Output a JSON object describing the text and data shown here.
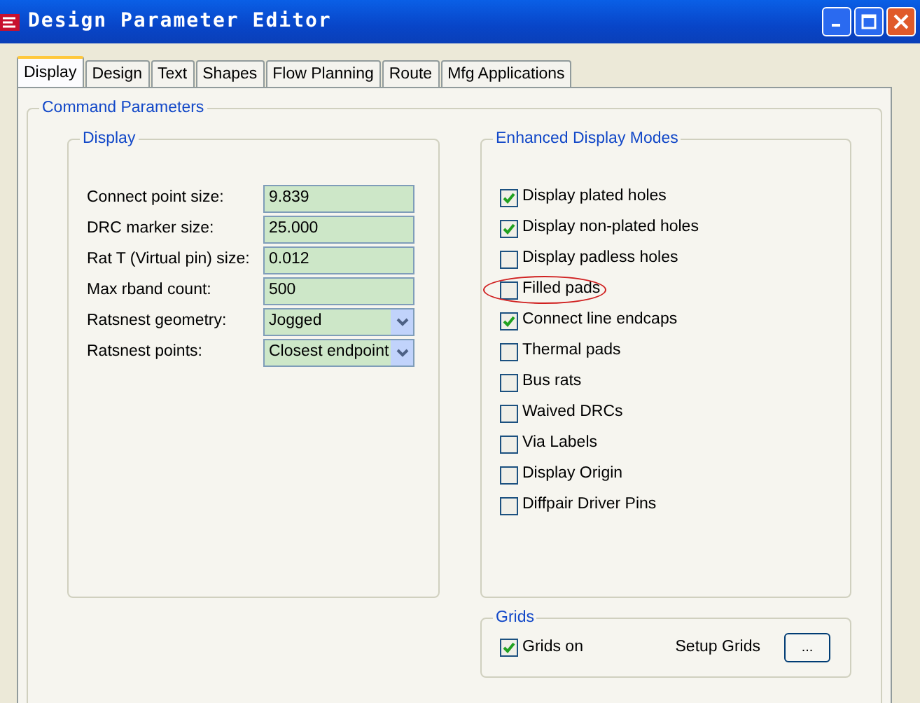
{
  "window": {
    "title": "Design Parameter Editor"
  },
  "tabs": [
    {
      "label": "Display",
      "selected": true
    },
    {
      "label": "Design",
      "selected": false
    },
    {
      "label": "Text",
      "selected": false
    },
    {
      "label": "Shapes",
      "selected": false
    },
    {
      "label": "Flow Planning",
      "selected": false
    },
    {
      "label": "Route",
      "selected": false
    },
    {
      "label": "Mfg Applications",
      "selected": false
    }
  ],
  "command_parameters": {
    "title": "Command Parameters",
    "display": {
      "title": "Display",
      "fields": [
        {
          "kind": "text",
          "label": "Connect point size:",
          "value": "9.839"
        },
        {
          "kind": "text",
          "label": "DRC marker size:",
          "value": "25.000"
        },
        {
          "kind": "text",
          "label": "Rat T (Virtual pin) size:",
          "value": "0.012"
        },
        {
          "kind": "text",
          "label": "Max rband count:",
          "value": "500"
        },
        {
          "kind": "select",
          "label": "Ratsnest geometry:",
          "value": "Jogged"
        },
        {
          "kind": "select",
          "label": "Ratsnest points:",
          "value": "Closest endpoint"
        }
      ]
    },
    "enhanced_display_modes": {
      "title": "Enhanced Display Modes",
      "options": [
        {
          "label": "Display plated holes",
          "checked": true,
          "circled": false
        },
        {
          "label": "Display non-plated holes",
          "checked": true,
          "circled": false
        },
        {
          "label": "Display padless holes",
          "checked": false,
          "circled": false
        },
        {
          "label": "Filled pads",
          "checked": false,
          "circled": true
        },
        {
          "label": "Connect line endcaps",
          "checked": true,
          "circled": false
        },
        {
          "label": "Thermal pads",
          "checked": false,
          "circled": false
        },
        {
          "label": "Bus rats",
          "checked": false,
          "circled": false
        },
        {
          "label": "Waived DRCs",
          "checked": false,
          "circled": false
        },
        {
          "label": "Via Labels",
          "checked": false,
          "circled": false
        },
        {
          "label": "Display Origin",
          "checked": false,
          "circled": false
        },
        {
          "label": "Diffpair Driver Pins",
          "checked": false,
          "circled": false
        }
      ]
    },
    "grids": {
      "title": "Grids",
      "grids_on": {
        "label": "Grids on",
        "checked": true
      },
      "setup_label": "Setup Grids",
      "setup_button": "..."
    }
  }
}
